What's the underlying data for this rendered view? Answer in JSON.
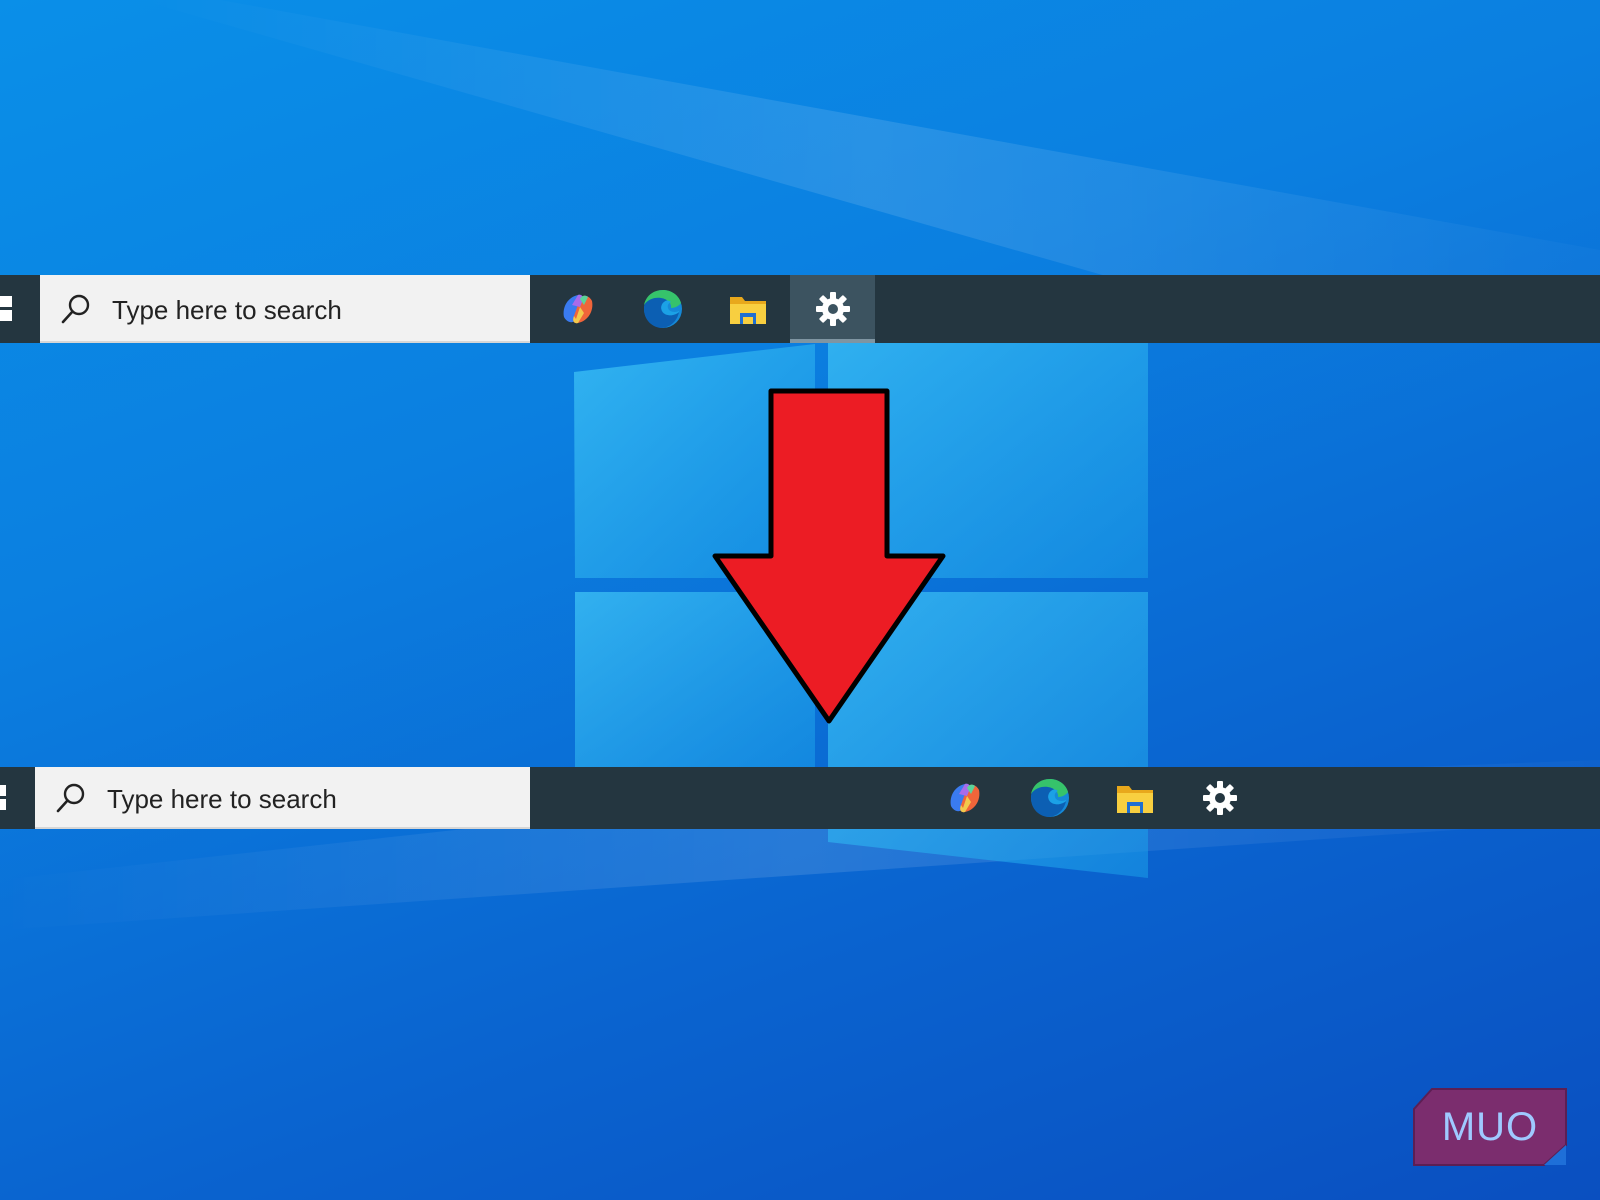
{
  "desktop": {
    "watermark": "MUO"
  },
  "taskbar_before": {
    "search": {
      "placeholder": "Type here to search"
    },
    "pinned_apps": [
      {
        "name": "Copilot",
        "icon": "copilot-icon"
      },
      {
        "name": "Microsoft Edge",
        "icon": "edge-icon"
      },
      {
        "name": "File Explorer",
        "icon": "folder-icon"
      },
      {
        "name": "Settings",
        "icon": "gear-icon",
        "active": true
      }
    ],
    "alignment": "left"
  },
  "taskbar_after": {
    "search": {
      "placeholder": "Type here to search"
    },
    "pinned_apps": [
      {
        "name": "Copilot",
        "icon": "copilot-icon"
      },
      {
        "name": "Microsoft Edge",
        "icon": "edge-icon"
      },
      {
        "name": "File Explorer",
        "icon": "folder-icon"
      },
      {
        "name": "Settings",
        "icon": "gear-icon"
      }
    ],
    "alignment": "center"
  },
  "colors": {
    "taskbar": "#243640",
    "search_box": "#f2f2f2",
    "arrow": "#ec1c24",
    "watermark_bg": "#7b2d6e"
  }
}
